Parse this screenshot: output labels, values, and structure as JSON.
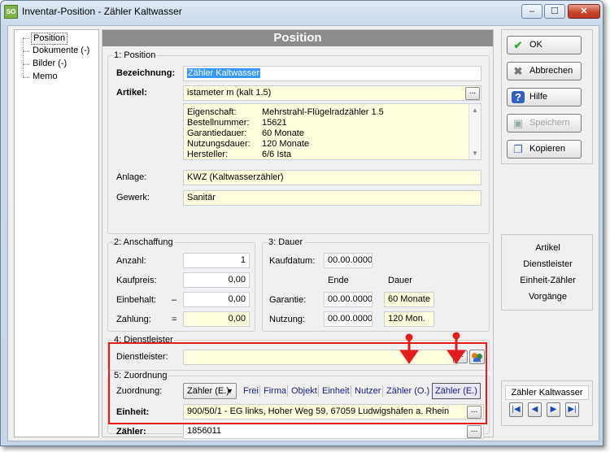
{
  "window": {
    "title": "Inventar-Position - Zähler Kaltwasser",
    "min": "–",
    "max": "☐",
    "close": "✕",
    "app_icon_text": "SO"
  },
  "tree": {
    "items": [
      {
        "label": "Position",
        "selected": true
      },
      {
        "label": "Dokumente (-)"
      },
      {
        "label": "Bilder (-)"
      },
      {
        "label": "Memo"
      }
    ]
  },
  "header": {
    "title": "Position"
  },
  "position": {
    "group_label": "1: Position",
    "bezeichnung_label": "Bezeichnung:",
    "bezeichnung_value": "Zähler Kaltwasser",
    "artikel_label": "Artikel:",
    "artikel_value": "istameter m (kalt 1.5)",
    "dots": "...",
    "info": [
      {
        "key": "Eigenschaft:",
        "value": "Mehrstrahl-Flügelradzähler 1.5"
      },
      {
        "key": "Bestellnummer:",
        "value": "15621"
      },
      {
        "key": "Garantiedauer:",
        "value": "60 Monate"
      },
      {
        "key": "Nutzungsdauer:",
        "value": "120 Monate"
      },
      {
        "key": "Hersteller:",
        "value": "6/6 Ista"
      }
    ],
    "anlage_label": "Anlage:",
    "anlage_value": "KWZ (Kaltwasserzähler)",
    "gewerk_label": "Gewerk:",
    "gewerk_value": "Sanitär"
  },
  "anschaffung": {
    "group_label": "2: Anschaffung",
    "anzahl_label": "Anzahl:",
    "anzahl_value": "1",
    "kaufpreis_label": "Kaufpreis:",
    "kaufpreis_value": "0,00",
    "einbehalt_label": "Einbehalt:",
    "einbehalt_op": "–",
    "einbehalt_value": "0,00",
    "zahlung_label": "Zahlung:",
    "zahlung_op": "=",
    "zahlung_value": "0,00"
  },
  "dauer": {
    "group_label": "3: Dauer",
    "kaufdatum_label": "Kaufdatum:",
    "kaufdatum_value": "00.00.0000",
    "col_ende": "Ende",
    "col_dauer": "Dauer",
    "garantie_label": "Garantie:",
    "garantie_ende": "00.00.0000",
    "garantie_dauer": "60 Monate",
    "nutzung_label": "Nutzung:",
    "nutzung_ende": "00.00.0000",
    "nutzung_dauer": "120 Mon."
  },
  "dienstleister": {
    "group_label": "4: Dienstleister",
    "label": "Dienstleister:",
    "value": "",
    "dots": "..."
  },
  "zuordnung": {
    "group_label": "5: Zuordnung",
    "label": "Zuordnung:",
    "combo_value": "Zähler (E.)",
    "tabs": [
      "Frei",
      "Firma",
      "Objekt",
      "Einheit",
      "Nutzer",
      "Zähler (O.)",
      "Zähler (E.)"
    ],
    "einheit_label": "Einheit:",
    "einheit_value": "900/50/1 - EG links, Hoher Weg 59, 67059 Ludwigshafen a. Rhein",
    "zaehler_label": "Zähler:",
    "zaehler_value": "1856011",
    "dots": "..."
  },
  "actions": {
    "ok": "OK",
    "abbrechen": "Abbrechen",
    "hilfe": "Hilfe",
    "speichern": "Speichern",
    "kopieren": "Kopieren"
  },
  "links": [
    "Artikel",
    "Dienstleister",
    "Einheit-Zähler",
    "Vorgänge"
  ],
  "record": {
    "name": "Zähler Kaltwasser",
    "nav": [
      "|◀",
      "◀",
      "▶",
      "▶|"
    ]
  },
  "colors": {
    "highlight": "#e41c1c",
    "field_yellow": "#ffffe0",
    "header_gray": "#8c8c8c"
  }
}
